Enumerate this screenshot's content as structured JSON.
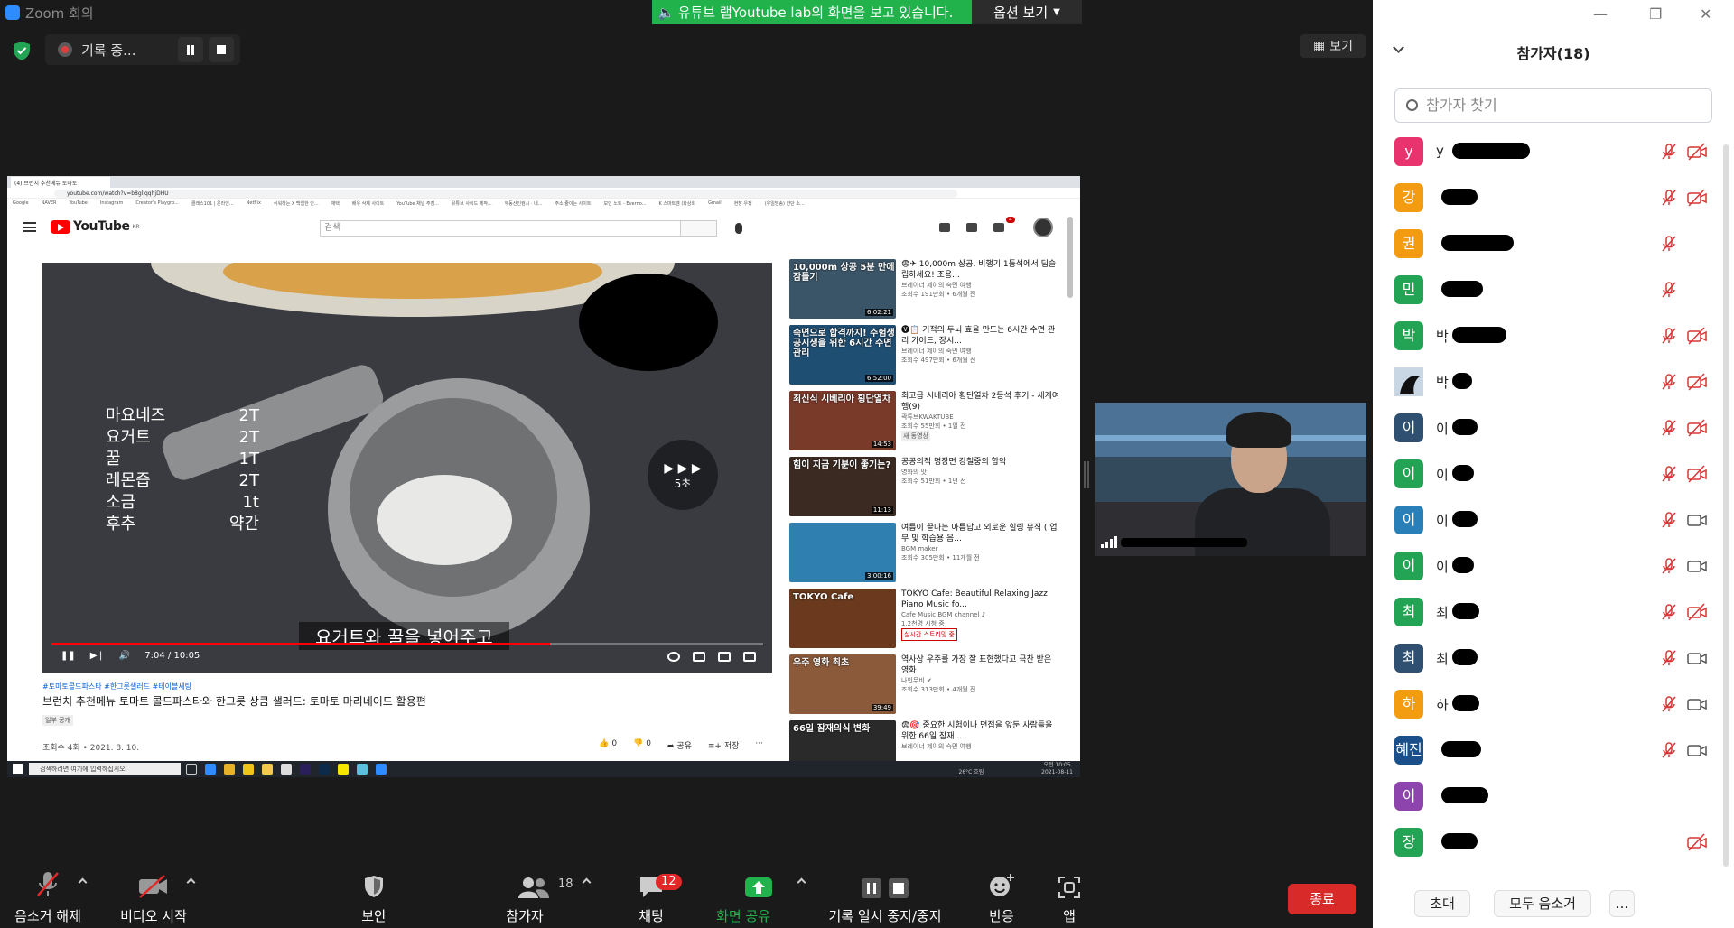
{
  "window": {
    "title": "Zoom 회의"
  },
  "share_banner": {
    "text": "유튜브 랩Youtube lab의 화면을 보고 있습니다.",
    "options_label": "옵션 보기"
  },
  "recording": {
    "label": "기록 중..."
  },
  "view_button": {
    "label": "보기"
  },
  "browser": {
    "tab_title": "(4) 브런치 추천메뉴 토마토",
    "url": "youtube.com/watch?v=b8gliqqhjDHU",
    "bookmarks": [
      "Google",
      "NAVER",
      "YouTube",
      "Instagram",
      "Creator's Playgro...",
      "클래스101 | 온라인...",
      "Netflix",
      "쉬워하는 X 백업한 인...",
      "재택",
      "배우 삭제 사이트",
      "YouTube 채널 주점...",
      "유튜브 사이드 제작...",
      "부동산인컴시 · 네...",
      "주소 줄이는 사이트",
      "모인 노트 - Everno...",
      "K 스마트엠 (화상회",
      "Gmail",
      "현장 우정",
      "(유일방송) 한단 소..."
    ]
  },
  "youtube": {
    "logo": "YouTube",
    "region": "KR",
    "search_placeholder": "검색",
    "notif_count": "4",
    "player": {
      "recipe": [
        {
          "item": "마요네즈",
          "qty": "2T"
        },
        {
          "item": "요거트",
          "qty": "2T"
        },
        {
          "item": "꿀",
          "qty": "1T"
        },
        {
          "item": "레몬즙",
          "qty": "2T"
        },
        {
          "item": "소금",
          "qty": "1t"
        },
        {
          "item": "후추",
          "qty": "약간"
        }
      ],
      "skip_label": "5초",
      "subtitle": "요거트와 꿀을 넣어주고",
      "time": "7:04 / 10:05",
      "progress": 0.7
    },
    "video": {
      "tags": "#토마토콜드파스타 #한그릇샐러드 #테이블세팅",
      "title": "브런치 추천메뉴 토마토 콜드파스타와 한그릇 상큼 샐러드: 토마토 마리네이드 활용편",
      "visibility": "일부 공개",
      "meta": "조회수 4회 • 2021. 8. 10.",
      "likes": "0",
      "dislikes": "0",
      "share": "공유",
      "save": "저장"
    },
    "recommendations": [
      {
        "title": "😨✈ 10,000m 상공, 비행기 1등석에서 딥슬립하세요! 조용...",
        "channel": "브레이너 제이의 숙면 여행",
        "meta": "조회수 191만회 • 6개월 전",
        "duration": "6:02:21",
        "thumb_text": "10,000m 상공 5분 만에 잠들기",
        "color": "#3b5568"
      },
      {
        "title": "🅥📋 기적의 두뇌 효율 만드는 6시간 수면 관리 가이드, 장시...",
        "channel": "브레이너 제이의 숙면 여행",
        "meta": "조회수 497만회 • 6개월 전",
        "duration": "6:52:00",
        "thumb_text": "숙면으로 합격까지! 수험생 공시생을 위한 6시간 수면관리",
        "color": "#1f4e73"
      },
      {
        "title": "최고급 시베리아 횡단열차 2등석 후기 - 세계여행(9)",
        "channel": "곽튜브KWAKTUBE",
        "meta": "조회수 55만회 • 1일 전",
        "badge": "새 동영상",
        "duration": "14:53",
        "thumb_text": "최신식 시베리아 횡단열차",
        "color": "#7a3a2a"
      },
      {
        "title": "공공의적 명장면 강철중의 합악",
        "channel": "영화의 맛",
        "meta": "조회수 51만회 • 1년 전",
        "duration": "11:13",
        "thumb_text": "힘이 지금 기분이 좋기는?",
        "color": "#3a2a22"
      },
      {
        "title": "여름이 끝나는 아름답고 외로운 힐링 뮤직 ( 업무 및 학습용 음...",
        "channel": "BGM maker",
        "meta": "조회수 305만회 • 11개월 전",
        "duration": "3:00:16",
        "thumb_text": "",
        "color": "#2f7fb0"
      },
      {
        "title": "TOKYO Cafe: Beautiful Relaxing Jazz Piano Music fo...",
        "channel": "Cafe Music BGM channel ♪",
        "meta": "1.2천명 시청 중",
        "live": "실시간 스트리밍 중",
        "duration": "",
        "thumb_text": "TOKYO Cafe",
        "color": "#6b3a1e"
      },
      {
        "title": "역사상 우주를 가장 잘 표현했다고 극찬 받은 영화",
        "channel": "나인무비 ✔",
        "meta": "조회수 313만회 • 4개월 전",
        "duration": "39:49",
        "thumb_text": "우주 영화 최초",
        "color": "#8a5a3a"
      },
      {
        "title": "😨🎯 중요한 시험이나 면접을 앞둔 사람들을 위한 66일 잠재...",
        "channel": "브레이너 제이의 숙면 여행",
        "meta": "",
        "duration": "",
        "thumb_text": "66일 잠재의식 변화",
        "color": "#2a2a2a"
      }
    ]
  },
  "taskbar": {
    "search": "검색하려면 여기에 입력하십시오.",
    "weather": "26°C 흐림",
    "clock": "오전 10:05",
    "date": "2021-08-11"
  },
  "participants_panel": {
    "title": "참가자(18)",
    "search_placeholder": "참가자 찾기",
    "participants": [
      {
        "initial": "y",
        "color": "#e8336e",
        "mic": "muted",
        "video": "off",
        "redact": 86,
        "name_start": "y"
      },
      {
        "initial": "강",
        "color": "#f39c12",
        "mic": "muted",
        "video": "off",
        "redact": 40,
        "name_start": ""
      },
      {
        "initial": "권",
        "color": "#f39c12",
        "mic": "muted",
        "video": "none",
        "redact": 80,
        "name_start": ""
      },
      {
        "initial": "민",
        "color": "#23a455",
        "mic": "muted",
        "video": "none",
        "redact": 46,
        "name_start": ""
      },
      {
        "initial": "박",
        "color": "#23a455",
        "mic": "muted",
        "video": "off",
        "redact": 60,
        "name_start": "박"
      },
      {
        "initial": "",
        "color": "#1a2c40",
        "mic": "muted",
        "video": "off",
        "redact": 22,
        "name_start": "박",
        "photo": true
      },
      {
        "initial": "이",
        "color": "#2f5070",
        "mic": "muted",
        "video": "off",
        "redact": 28,
        "name_start": "이"
      },
      {
        "initial": "이",
        "color": "#23a455",
        "mic": "muted",
        "video": "off",
        "redact": 24,
        "name_start": "이"
      },
      {
        "initial": "이",
        "color": "#2980b9",
        "mic": "muted",
        "video": "on",
        "redact": 28,
        "name_start": "이"
      },
      {
        "initial": "이",
        "color": "#23a455",
        "mic": "muted",
        "video": "on",
        "redact": 24,
        "name_start": "이"
      },
      {
        "initial": "최",
        "color": "#23a455",
        "mic": "muted",
        "video": "off",
        "redact": 30,
        "name_start": "최"
      },
      {
        "initial": "최",
        "color": "#2f5070",
        "mic": "muted",
        "video": "on",
        "redact": 28,
        "name_start": "최"
      },
      {
        "initial": "하",
        "color": "#f39c12",
        "mic": "muted",
        "video": "on",
        "redact": 30,
        "name_start": "하"
      },
      {
        "initial": "혜진",
        "color": "#1a4f8a",
        "mic": "muted",
        "video": "on",
        "redact": 44,
        "name_start": ""
      },
      {
        "initial": "이",
        "color": "#8e44ad",
        "mic": "none",
        "video": "none",
        "redact": 52,
        "name_start": ""
      },
      {
        "initial": "장",
        "color": "#23a455",
        "mic": "none",
        "video": "off",
        "redact": 40,
        "name_start": ""
      }
    ],
    "footer": {
      "invite": "초대",
      "mute_all": "모두 음소거",
      "more": "..."
    }
  },
  "toolbar": {
    "unmute": "음소거 해제",
    "start_video": "비디오 시작",
    "security": "보안",
    "participants": "참가자",
    "participants_count": "18",
    "chat": "채팅",
    "chat_badge": "12",
    "share": "화면 공유",
    "pause_recording": "기록 일시 중지/중지",
    "reactions": "반응",
    "apps": "앱",
    "end": "종료"
  },
  "colors": {
    "accent_green": "#22b24c",
    "end_red": "#d92a2a",
    "mute_red": "#e02828"
  }
}
